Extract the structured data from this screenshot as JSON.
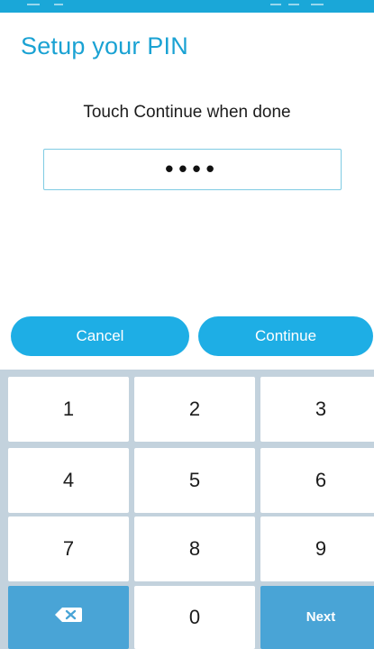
{
  "colors": {
    "accent": "#1aa2d3",
    "button": "#1eaee5",
    "keypad_bg": "#c3d2dd",
    "action_key": "#49a4d6"
  },
  "header": {
    "title": "Setup your PIN"
  },
  "instruction": "Touch Continue when done",
  "pin": {
    "masked_value": "••••"
  },
  "buttons": {
    "cancel": "Cancel",
    "continue": "Continue"
  },
  "keypad": {
    "keys": [
      "1",
      "2",
      "3",
      "4",
      "5",
      "6",
      "7",
      "8",
      "9"
    ],
    "zero": "0",
    "backspace_icon": "backspace-icon",
    "next": "Next"
  }
}
